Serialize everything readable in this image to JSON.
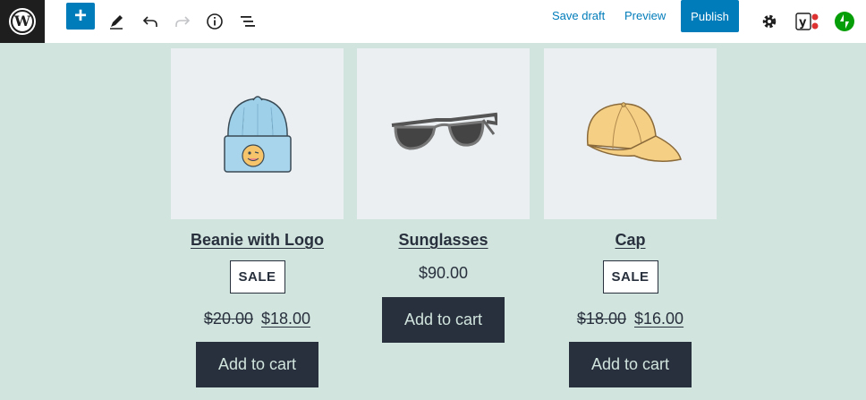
{
  "toolbar": {
    "save_draft": "Save draft",
    "preview": "Preview",
    "publish": "Publish",
    "icons": [
      "wordpress-logo",
      "add-block",
      "tools-edit",
      "undo",
      "redo",
      "info",
      "list-view",
      "settings",
      "yoast",
      "jetpack"
    ]
  },
  "products": [
    {
      "name": "Beanie with Logo",
      "badge": "SALE",
      "regular_price": "$20.00",
      "sale_price": "$18.00",
      "button": "Add to cart"
    },
    {
      "name": "Sunglasses",
      "price": "$90.00",
      "button": "Add to cart"
    },
    {
      "name": "Cap",
      "badge": "SALE",
      "regular_price": "$18.00",
      "sale_price": "$16.00",
      "button": "Add to cart"
    }
  ],
  "colors": {
    "canvas": "#d1e4dd",
    "accent": "#007cba",
    "dark": "#28303d"
  }
}
